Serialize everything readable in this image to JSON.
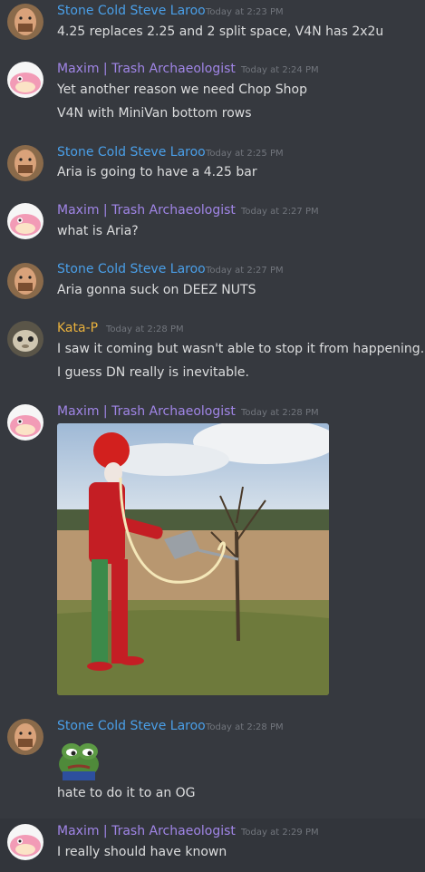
{
  "users": {
    "steve": {
      "name": "Stone Cold Steve Laroo",
      "color": "#4a9fe8"
    },
    "maxim": {
      "name": "Maxim | Trash Archaeologist",
      "color": "#a085e6"
    },
    "kata": {
      "name": "Kata-P",
      "color": "#e9b13d"
    }
  },
  "messages": [
    {
      "ts": "Today at 2:23 PM",
      "lines": [
        "4.25 replaces 2.25 and 2 split space, V4N has 2x2u"
      ]
    },
    {
      "ts": "Today at 2:24 PM",
      "lines": [
        "Yet another reason we need Chop Shop",
        "V4N with MiniVan bottom rows"
      ]
    },
    {
      "ts": "Today at 2:25 PM",
      "lines": [
        "Aria is going to have a 4.25 bar"
      ]
    },
    {
      "ts": "Today at 2:27 PM",
      "lines": [
        "what is Aria?"
      ]
    },
    {
      "ts": "Today at 2:27 PM",
      "lines": [
        "Aria gonna suck on DEEZ NUTS"
      ]
    },
    {
      "ts": "Today at 2:28 PM",
      "lines": [
        "I saw it coming but wasn't able to stop it from happening.",
        "I guess DN really is inevitable."
      ]
    },
    {
      "ts": "Today at 2:28 PM",
      "lines": []
    },
    {
      "ts": "Today at 2:28 PM",
      "lines": [
        "hate to do it to an OG"
      ]
    },
    {
      "ts": "Today at 2:29 PM",
      "lines": [
        "I really should have known"
      ]
    }
  ]
}
